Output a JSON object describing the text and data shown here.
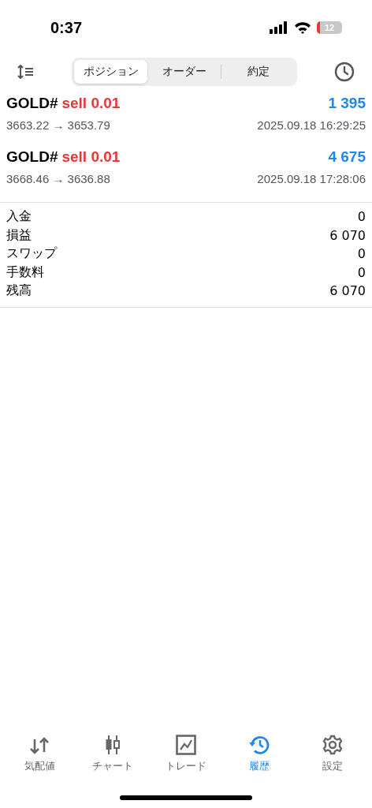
{
  "status_bar": {
    "time": "0:37",
    "battery": "12"
  },
  "tabs": [
    {
      "label": "ポジション",
      "selected": true
    },
    {
      "label": "オーダー",
      "selected": false
    },
    {
      "label": "約定",
      "selected": false
    }
  ],
  "trades": [
    {
      "symbol": "GOLD#",
      "side": "sell 0.01",
      "profit": "1 395",
      "prices": "3663.22 → 3653.79",
      "time": "2025.09.18 16:29:25"
    },
    {
      "symbol": "GOLD#",
      "side": "sell 0.01",
      "profit": "4 675",
      "prices": "3668.46 → 3636.88",
      "time": "2025.09.18 17:28:06"
    }
  ],
  "summary": [
    {
      "label": "入金",
      "value": "0"
    },
    {
      "label": "損益",
      "value": "6 070"
    },
    {
      "label": "スワップ",
      "value": "0"
    },
    {
      "label": "手数料",
      "value": "0"
    },
    {
      "label": "残高",
      "value": "6 070"
    }
  ],
  "nav": [
    {
      "kind": "quotes",
      "label": "気配値",
      "selected": false
    },
    {
      "kind": "chart",
      "label": "チャート",
      "selected": false
    },
    {
      "kind": "trade",
      "label": "トレード",
      "selected": false
    },
    {
      "kind": "history",
      "label": "履歴",
      "selected": true
    },
    {
      "kind": "settings",
      "label": "設定",
      "selected": false
    }
  ]
}
